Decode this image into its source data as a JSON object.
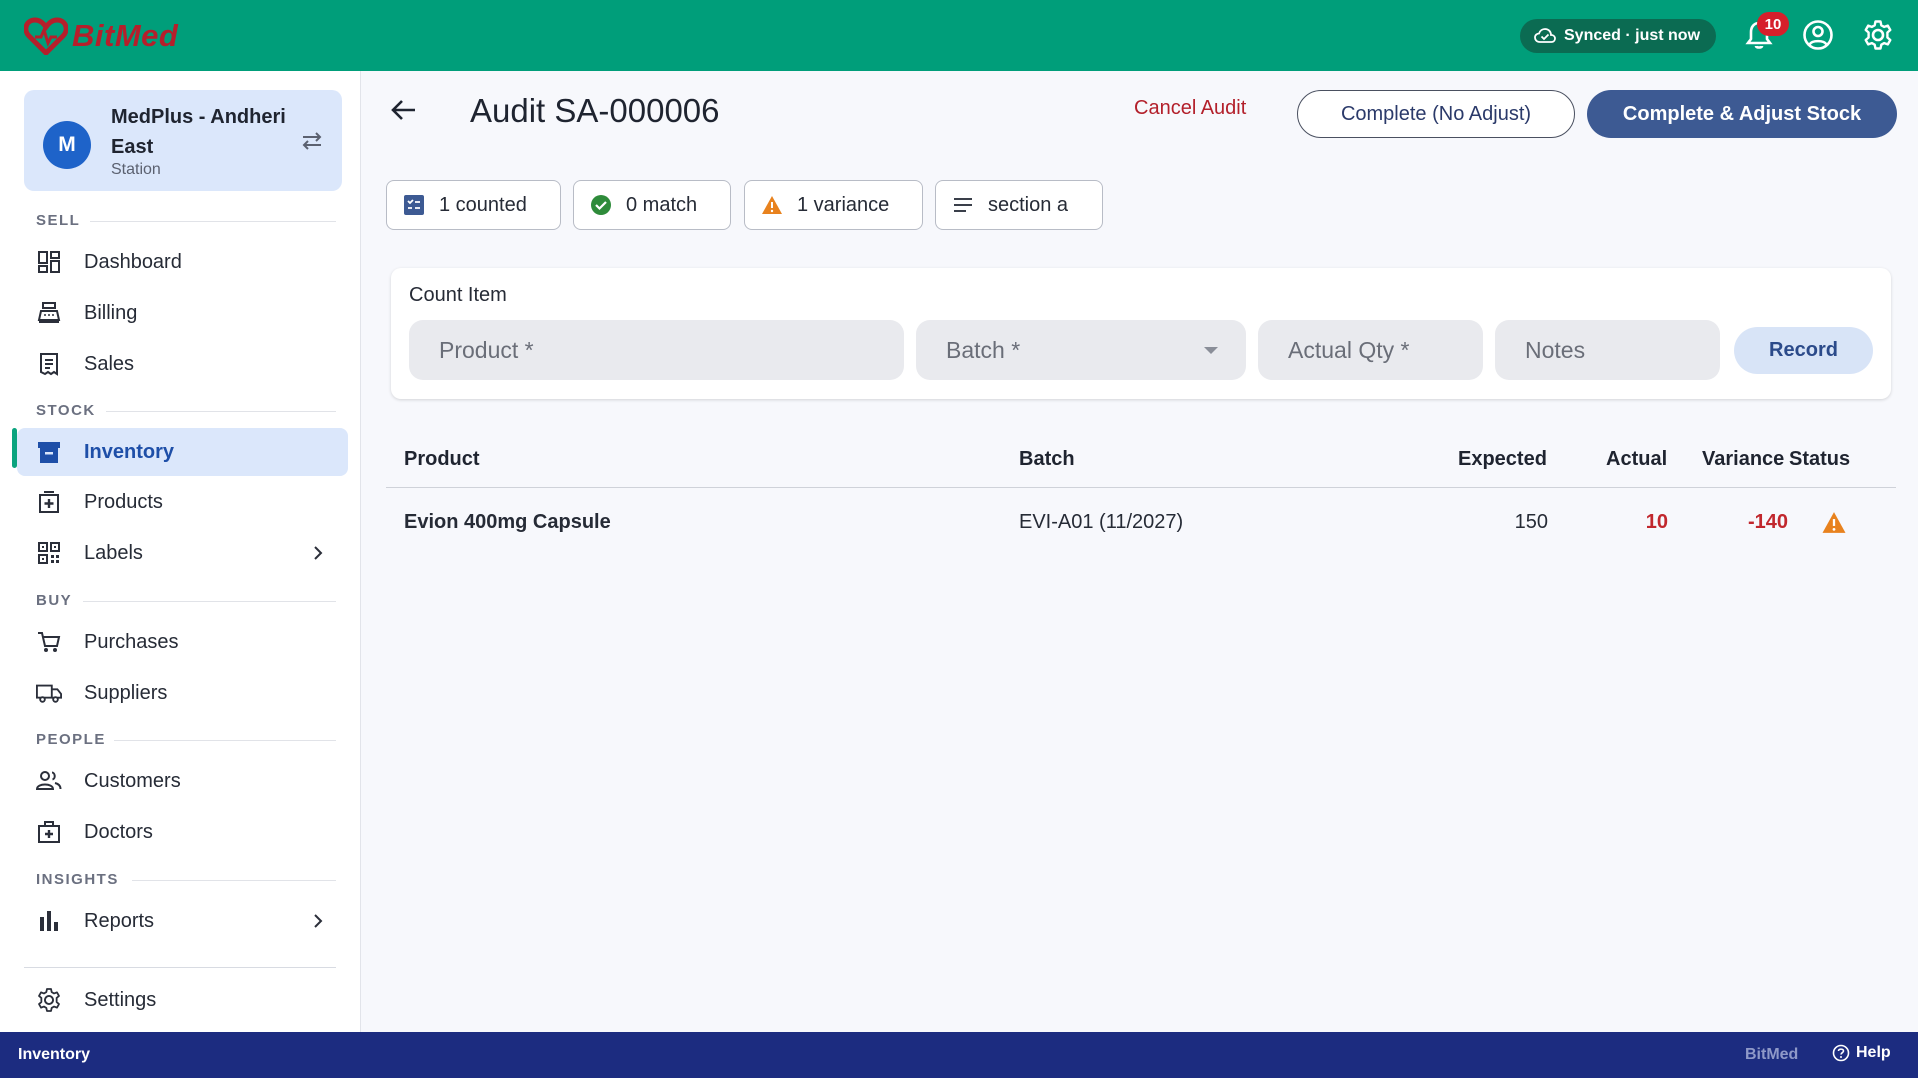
{
  "app": {
    "brand": "BitMed",
    "sync_status": "Synced · just now",
    "notification_count": "10"
  },
  "store": {
    "initial": "M",
    "name": "MedPlus - Andheri East",
    "subtitle": "Station"
  },
  "sidebar": {
    "sections": [
      {
        "label": "SELL"
      },
      {
        "label": "STOCK"
      },
      {
        "label": "BUY"
      },
      {
        "label": "PEOPLE"
      },
      {
        "label": "INSIGHTS"
      }
    ],
    "items": [
      {
        "label": "Dashboard",
        "icon": "dashboard-icon"
      },
      {
        "label": "Billing",
        "icon": "cash-register-icon"
      },
      {
        "label": "Sales",
        "icon": "receipt-icon"
      },
      {
        "label": "Inventory",
        "icon": "archive-icon",
        "active": true
      },
      {
        "label": "Products",
        "icon": "medical-box-icon"
      },
      {
        "label": "Labels",
        "icon": "qr-code-icon"
      },
      {
        "label": "Purchases",
        "icon": "cart-icon"
      },
      {
        "label": "Suppliers",
        "icon": "truck-icon"
      },
      {
        "label": "Customers",
        "icon": "people-icon"
      },
      {
        "label": "Doctors",
        "icon": "medical-bag-icon"
      },
      {
        "label": "Reports",
        "icon": "bar-chart-icon"
      },
      {
        "label": "Settings",
        "icon": "gear-icon"
      }
    ]
  },
  "page": {
    "title": "Audit SA-000006",
    "actions": {
      "cancel": "Cancel Audit",
      "complete_no_adjust": "Complete (No Adjust)",
      "complete_adjust": "Complete & Adjust Stock"
    },
    "chips": {
      "counted": "1 counted",
      "match": "0 match",
      "variance": "1 variance",
      "section": "section a"
    },
    "count_item": {
      "title": "Count Item",
      "product_placeholder": "Product *",
      "batch_placeholder": "Batch *",
      "qty_placeholder": "Actual Qty *",
      "notes_placeholder": "Notes",
      "record_label": "Record"
    },
    "table": {
      "headers": {
        "product": "Product",
        "batch": "Batch",
        "expected": "Expected",
        "actual": "Actual",
        "variance": "Variance",
        "status": "Status"
      },
      "rows": [
        {
          "product": "Evion 400mg Capsule",
          "batch": "EVI-A01 (11/2027)",
          "expected": "150",
          "actual": "10",
          "variance": "-140",
          "status": "warning-icon"
        }
      ]
    }
  },
  "footer": {
    "left": "Inventory",
    "brand": "BitMed",
    "help": "Help"
  },
  "colors": {
    "topbar": "#009e7a",
    "primary": "#3d5a93",
    "danger": "#c1272d",
    "warning": "#e8821e",
    "footer": "#1c2c80"
  }
}
